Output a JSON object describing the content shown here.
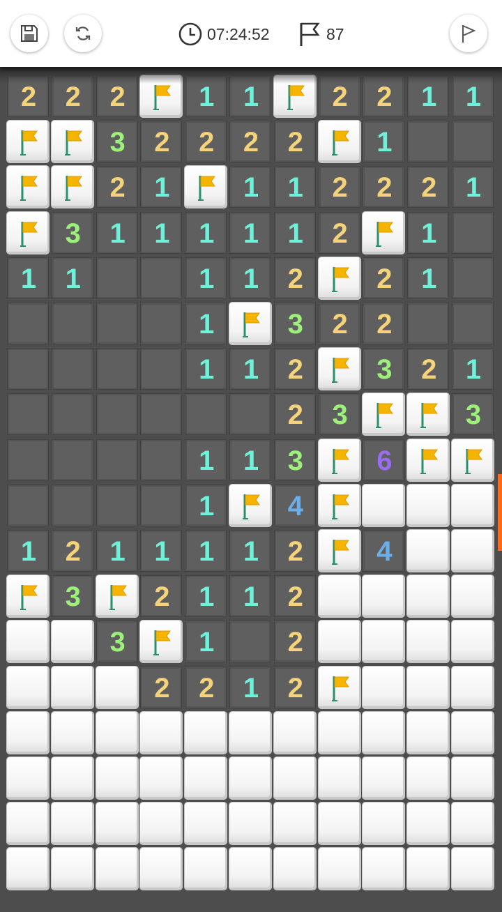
{
  "header": {
    "save_icon": "save-disk-icon",
    "restart_icon": "refresh-icon",
    "timer_icon": "clock-icon",
    "timer": "07:24:52",
    "flag_icon": "flag-icon",
    "flags_count": "87",
    "flag_mode_icon": "flag-outline-icon"
  },
  "colors": {
    "1": "#6ff0d8",
    "2": "#f5d37a",
    "3": "#9df07a",
    "4": "#6aaeea",
    "6": "#9a6cf0",
    "flag": "#f5b400",
    "scroll_accent": "#ff6a1a"
  },
  "board": {
    "cols": 11,
    "legend": "digits = revealed number, F = flagged, . = revealed empty, # = unrevealed",
    "rows": [
      "222F11F2211",
      "FF32222F1..",
      "FF21F112221.",
      "F3111112F1.",
      "11..112F21.",
      "....1F322..",
      "....112F321",
      "......23FF3",
      "....113F6FF",
      "....1F4F###",
      "1211112F4###",
      "F3F2112####",
      "##3F1.2####",
      "###2212F###",
      "###########",
      "###########",
      "###########",
      "###########"
    ]
  }
}
